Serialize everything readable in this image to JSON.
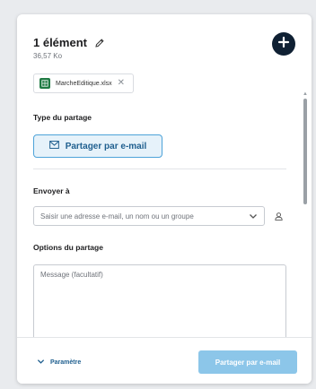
{
  "header": {
    "title": "1 élément",
    "size": "36,57 Ko"
  },
  "attachment": {
    "file_name": "MarcheEditique.xlsx",
    "icon": "excel-file-icon"
  },
  "share_type": {
    "label": "Type du partage",
    "email_button_label": "Partager par e-mail"
  },
  "send_to": {
    "label": "Envoyer à",
    "placeholder": "Saisir une adresse e-mail, un nom ou un groupe"
  },
  "options": {
    "label": "Options du partage",
    "message_placeholder": "Message (facultatif)"
  },
  "footer": {
    "params_label": "Paramètre",
    "submit_label": "Partager par e-mail"
  },
  "colors": {
    "accent": "#4da3d9",
    "dark": "#0f2033",
    "submit_disabled": "#8cc6e9",
    "excel_green": "#1f7a43"
  }
}
